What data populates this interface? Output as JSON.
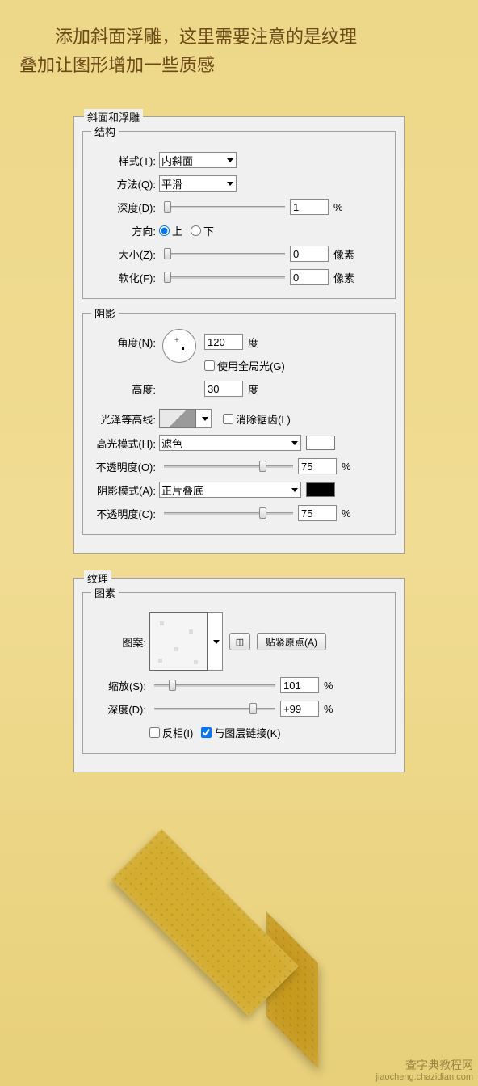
{
  "intro": {
    "line1": "添加斜面浮雕，这里需要注意的是纹理",
    "line2": "叠加让图形增加一些质感"
  },
  "panel1": {
    "title": "斜面和浮雕",
    "structure": {
      "title": "结构",
      "style_label": "样式(T):",
      "style_value": "内斜面",
      "method_label": "方法(Q):",
      "method_value": "平滑",
      "depth_label": "深度(D):",
      "depth_value": "1",
      "depth_unit": "%",
      "direction_label": "方向:",
      "dir_up": "上",
      "dir_down": "下",
      "size_label": "大小(Z):",
      "size_value": "0",
      "size_unit": "像素",
      "soften_label": "软化(F):",
      "soften_value": "0",
      "soften_unit": "像素"
    },
    "shading": {
      "title": "阴影",
      "angle_label": "角度(N):",
      "angle_value": "120",
      "angle_unit": "度",
      "global_light": "使用全局光(G)",
      "altitude_label": "高度:",
      "altitude_value": "30",
      "altitude_unit": "度",
      "gloss_label": "光泽等高线:",
      "antialias": "消除锯齿(L)",
      "highlight_mode_label": "高光模式(H):",
      "highlight_mode_value": "滤色",
      "highlight_opacity_label": "不透明度(O):",
      "highlight_opacity_value": "75",
      "highlight_opacity_unit": "%",
      "shadow_mode_label": "阴影模式(A):",
      "shadow_mode_value": "正片叠底",
      "shadow_opacity_label": "不透明度(C):",
      "shadow_opacity_value": "75",
      "shadow_opacity_unit": "%"
    }
  },
  "panel2": {
    "title": "纹理",
    "element": {
      "title": "图素",
      "pattern_label": "图案:",
      "snap_btn": "贴紧原点(A)",
      "scale_label": "缩放(S):",
      "scale_value": "101",
      "scale_unit": "%",
      "depth_label": "深度(D):",
      "depth_value": "+99",
      "depth_unit": "%",
      "invert": "反相(I)",
      "link": "与图层链接(K)"
    }
  },
  "watermark": {
    "main": "查字典教程网",
    "sub": "jiaocheng.chazidian.com"
  }
}
